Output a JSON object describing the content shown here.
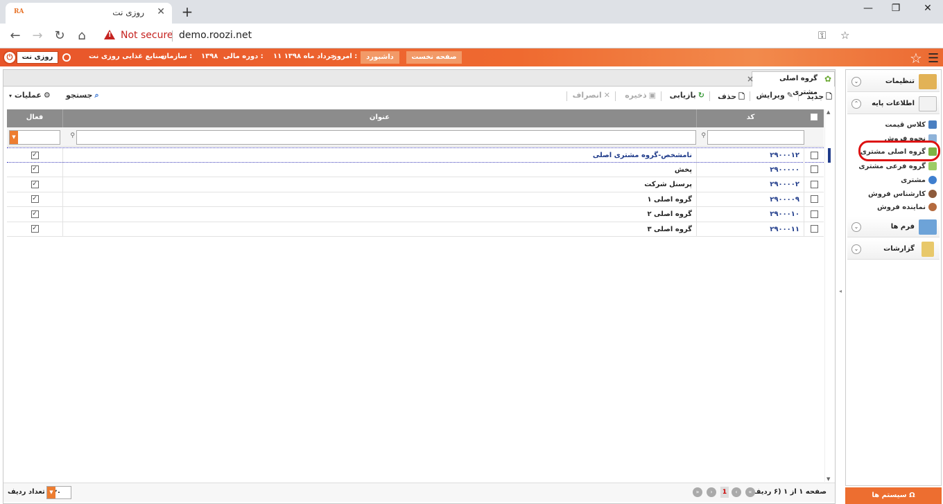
{
  "browser": {
    "tab_favicon": "RA",
    "tab_title": "روزی نت",
    "close_symbol": "✕",
    "new_tab_symbol": "+",
    "not_secure": "Not secure",
    "url": "demo.roozi.net",
    "window_controls": {
      "minimize": "—",
      "maximize": "❐",
      "close": "✕"
    }
  },
  "appbar": {
    "app_name": "روزی نت",
    "org_label": "سازمان :",
    "org_value": "صنایع غذایی روزی نت",
    "period_label": "دوره مالی :",
    "period_value": "۱۳۹۸",
    "today_label": "امروز :",
    "today_value": "۱۱ خرداد ماه ۱۳۹۸",
    "dashboard_btn": "داشبورد",
    "home_btn": "صفحه نخست",
    "accent_color": "#ee6a30"
  },
  "page_tab": {
    "title": "گروه اصلی مشتری",
    "close": "×"
  },
  "toolbar": {
    "new": "جدید",
    "edit": "ویرایش",
    "delete": "حذف",
    "refresh": "بازیابی",
    "save": "ذخیره",
    "cancel": "انصراف",
    "search": "جستجو",
    "operations": "عملیات"
  },
  "grid": {
    "columns": {
      "code": "کد",
      "title": "عنوان",
      "active": "فعال"
    },
    "rows": [
      {
        "code": "۲۹۰۰۰۱۲",
        "title": "نامشخص-گروه مشتری اصلی",
        "active": true
      },
      {
        "code": "۲۹۰۰۰۰۰",
        "title": "پخش",
        "active": true
      },
      {
        "code": "۲۹۰۰۰۰۲",
        "title": "پرسنل شرکت",
        "active": true
      },
      {
        "code": "۲۹۰۰۰۰۹",
        "title": "گروه اصلی ۱",
        "active": true
      },
      {
        "code": "۲۹۰۰۰۱۰",
        "title": "گروه اصلی ۲",
        "active": true
      },
      {
        "code": "۲۹۰۰۰۱۱",
        "title": "گروه اصلی ۳",
        "active": true
      }
    ]
  },
  "footer": {
    "page_info": "صفحه ۱ از ۱ (۶ ردیف)",
    "current_page": "1",
    "row_count_label": "تعداد ردیف",
    "row_count_value": "۳۰"
  },
  "sidebar": {
    "settings": "تنظیمات",
    "base_info": "اطلاعات پایه",
    "items": [
      {
        "label": "کلاس قیمت",
        "icon": "grid-icon"
      },
      {
        "label": "نحوه فروش",
        "icon": "sale-icon"
      },
      {
        "label": "گروه اصلی مشتری",
        "icon": "group-icon"
      },
      {
        "label": "گروه فرعی مشتری",
        "icon": "subgroup-icon"
      },
      {
        "label": "مشتری",
        "icon": "user-icon"
      },
      {
        "label": "کارشناس فروش",
        "icon": "expert-icon"
      },
      {
        "label": "نماینده فروش",
        "icon": "agent-icon"
      }
    ],
    "forms": "فرم ها",
    "reports": "گزارشات",
    "systems": "سیستم ها"
  }
}
